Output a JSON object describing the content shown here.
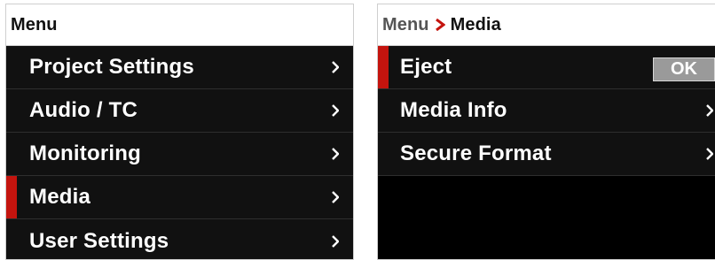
{
  "left_panel": {
    "header": "Menu",
    "items": [
      {
        "label": "Project Settings"
      },
      {
        "label": "Audio / TC"
      },
      {
        "label": "Monitoring"
      },
      {
        "label": "Media"
      },
      {
        "label": "User Settings"
      }
    ],
    "selected_index": 3
  },
  "right_panel": {
    "breadcrumb": {
      "parent": "Menu",
      "current": "Media"
    },
    "items": [
      {
        "label": "Eject",
        "button": "OK"
      },
      {
        "label": "Media Info"
      },
      {
        "label": "Secure Format"
      }
    ],
    "selected_index": 0
  },
  "colors": {
    "accent_red": "#c4140e",
    "row_background": "#111111",
    "button_gray": "#9a9a9a"
  },
  "icons": {
    "chevron": "chevron-right-icon",
    "breadcrumb_arrow": "breadcrumb-arrow-icon"
  }
}
